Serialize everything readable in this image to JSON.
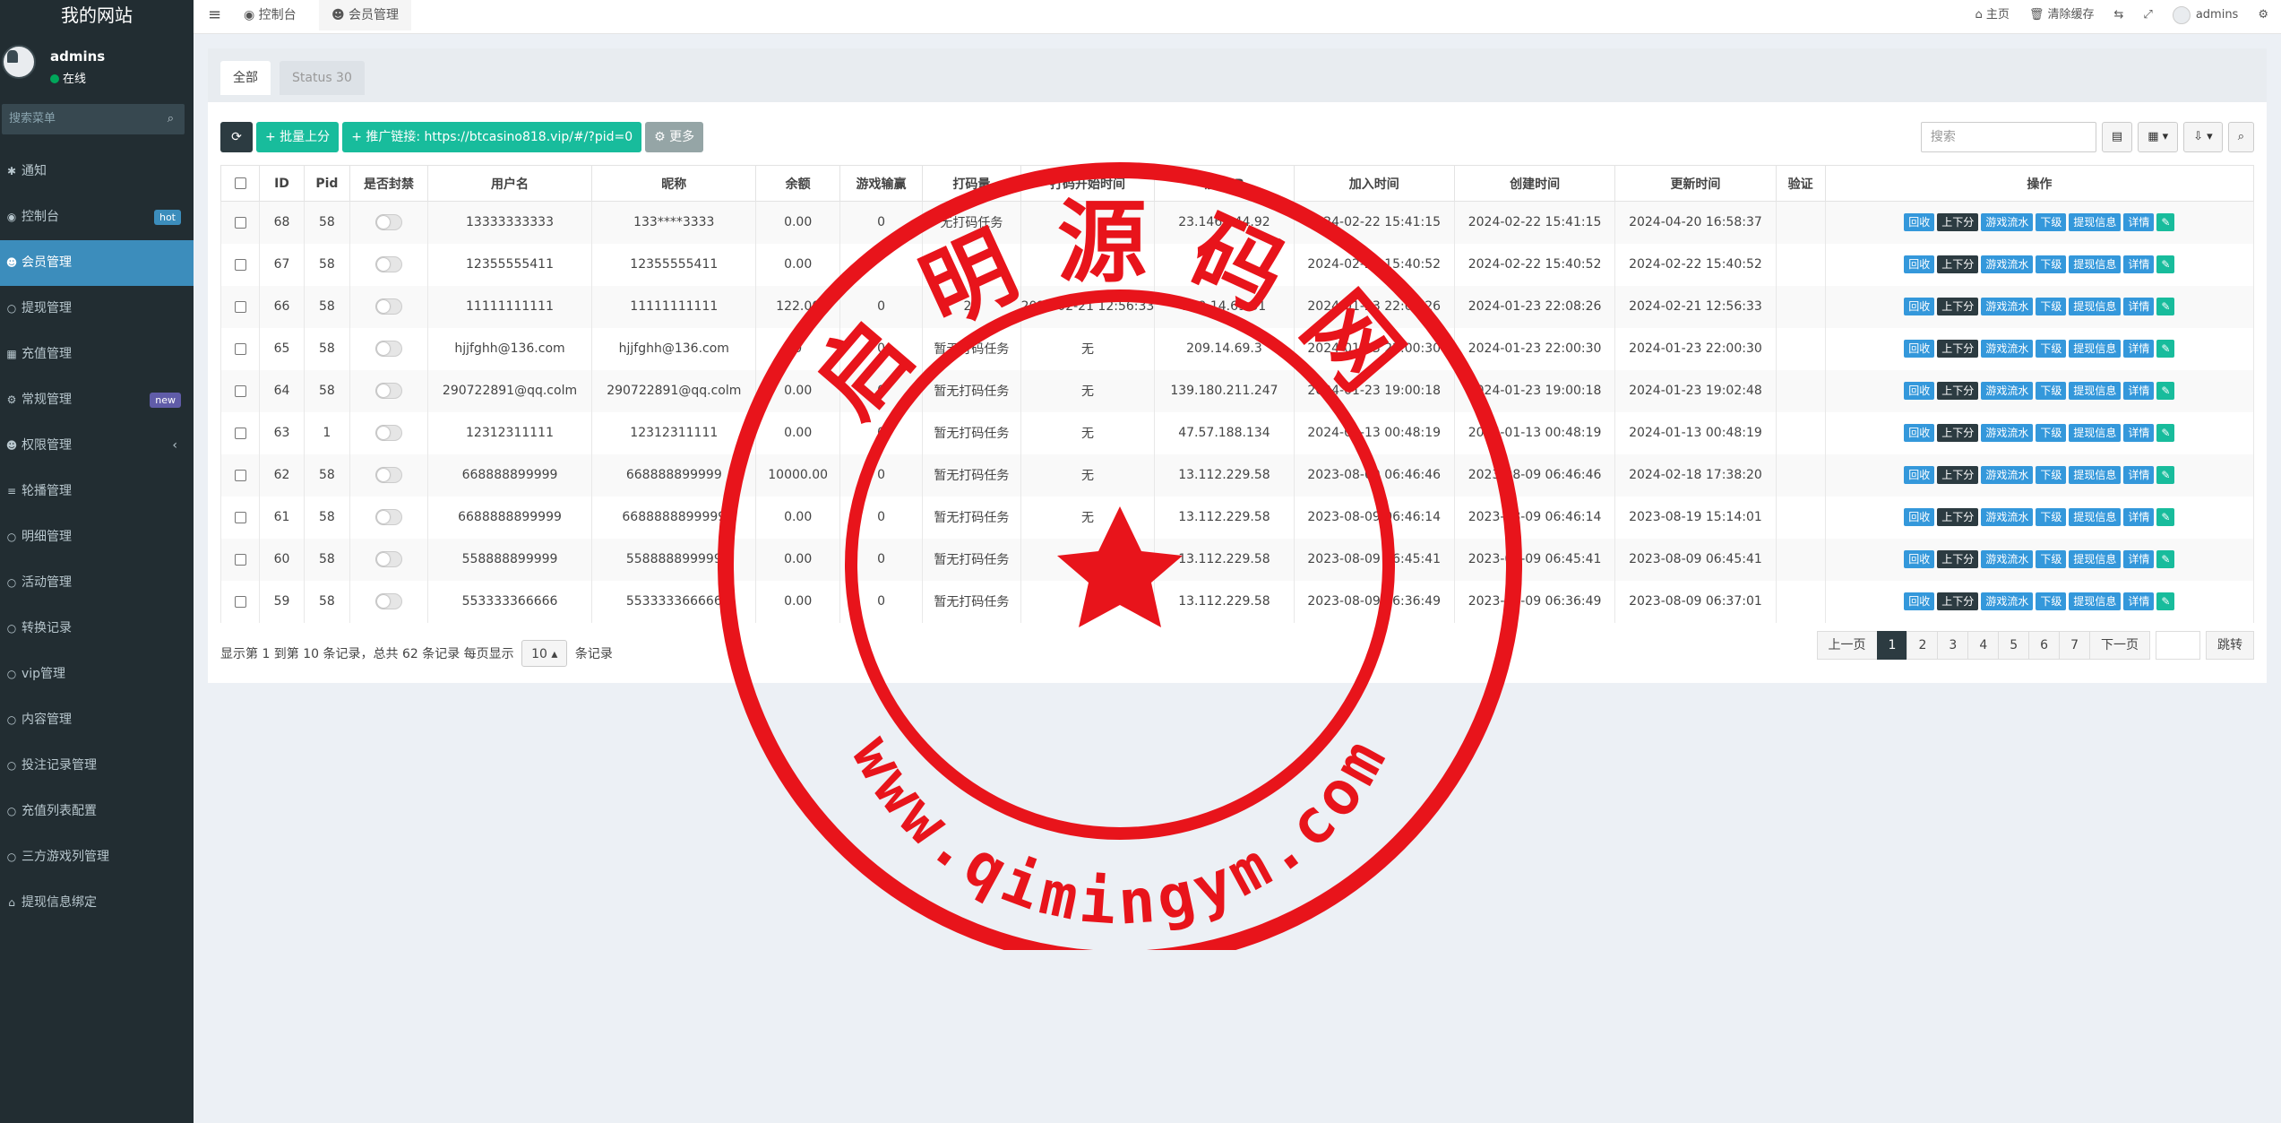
{
  "sidebar": {
    "site_title": "我的网站",
    "user": {
      "name": "admins",
      "status": "在线"
    },
    "search_placeholder": "搜索菜单",
    "items": [
      {
        "icon": "bell-icon",
        "glyph": "✱",
        "label": "通知"
      },
      {
        "icon": "dashboard-icon",
        "glyph": "◉",
        "label": "控制台",
        "badge": "hot"
      },
      {
        "icon": "users-icon",
        "glyph": "☻",
        "label": "会员管理",
        "active": true
      },
      {
        "icon": "circle-icon",
        "glyph": "○",
        "label": "提现管理"
      },
      {
        "icon": "grid-icon",
        "glyph": "▦",
        "label": "充值管理"
      },
      {
        "icon": "cogs-icon",
        "glyph": "⚙",
        "label": "常规管理",
        "badge": "new"
      },
      {
        "icon": "users-icon",
        "glyph": "☻",
        "label": "权限管理",
        "chevron": "‹"
      },
      {
        "icon": "list-icon",
        "glyph": "≡",
        "label": "轮播管理"
      },
      {
        "icon": "circle-icon",
        "glyph": "○",
        "label": "明细管理"
      },
      {
        "icon": "circle-icon",
        "glyph": "○",
        "label": "活动管理"
      },
      {
        "icon": "circle-icon",
        "glyph": "○",
        "label": "转换记录"
      },
      {
        "icon": "circle-icon",
        "glyph": "○",
        "label": "vip管理"
      },
      {
        "icon": "circle-icon",
        "glyph": "○",
        "label": "内容管理"
      },
      {
        "icon": "circle-icon",
        "glyph": "○",
        "label": "投注记录管理"
      },
      {
        "icon": "circle-icon",
        "glyph": "○",
        "label": "充值列表配置"
      },
      {
        "icon": "circle-icon",
        "glyph": "○",
        "label": "三方游戏列管理"
      },
      {
        "icon": "bank-icon",
        "glyph": "⌂",
        "label": "提现信息绑定"
      }
    ]
  },
  "topbar": {
    "tabs": [
      "控制台",
      "会员管理"
    ],
    "right": {
      "home": "主页",
      "clear_cache": "清除缓存",
      "user": "admins"
    }
  },
  "panel": {
    "tabs": [
      "全部",
      "Status 30"
    ],
    "toolbar": {
      "batch_label": "+ 批量上分",
      "promo_label": "+ 推广链接: https://btcasino818.vip/#/?pid=0",
      "more_label": "⚙ 更多"
    },
    "search_placeholder": "搜索",
    "columns": [
      "",
      "ID",
      "Pid",
      "是否封禁",
      "用户名",
      "昵称",
      "余额",
      "游戏输赢",
      "打码量",
      "打码开始时间",
      "加入IP",
      "加入时间",
      "创建时间",
      "更新时间",
      "验证",
      "操作"
    ],
    "rows": [
      {
        "id": "68",
        "pid": "58",
        "username": "13333333333",
        "nickname": "133****3333",
        "balance": "0.00",
        "winloss": "0",
        "bet": "无打码任务",
        "bet_start": "",
        "ip": "23.146.144.92",
        "join": "2024-02-22 15:41:15",
        "created": "2024-02-22 15:41:15",
        "updated": "2024-04-20 16:58:37"
      },
      {
        "id": "67",
        "pid": "58",
        "username": "12355555411",
        "nickname": "12355555411",
        "balance": "0.00",
        "winloss": "",
        "bet": "",
        "bet_start": "",
        "ip": "",
        "join": "2024-02-22 15:40:52",
        "created": "2024-02-22 15:40:52",
        "updated": "2024-02-22 15:40:52"
      },
      {
        "id": "66",
        "pid": "58",
        "username": "11111111111",
        "nickname": "11111111111",
        "balance": "122.00",
        "winloss": "0",
        "bet": "20",
        "bet_start": "2024-02-21 12:56:33",
        "ip": "209.14.69.31",
        "join": "2024-01-23 22:08:26",
        "created": "2024-01-23 22:08:26",
        "updated": "2024-02-21 12:56:33"
      },
      {
        "id": "65",
        "pid": "58",
        "username": "hjjfghh@136.com",
        "nickname": "hjjfghh@136.com",
        "balance": "0",
        "winloss": "0",
        "bet": "暂无打码任务",
        "bet_start": "无",
        "ip": "209.14.69.3",
        "join": "2024-01-23 22:00:30",
        "created": "2024-01-23 22:00:30",
        "updated": "2024-01-23 22:00:30"
      },
      {
        "id": "64",
        "pid": "58",
        "username": "290722891@qq.colm",
        "nickname": "290722891@qq.colm",
        "balance": "0.00",
        "winloss": "0",
        "bet": "暂无打码任务",
        "bet_start": "无",
        "ip": "139.180.211.247",
        "join": "2024-01-23 19:00:18",
        "created": "2024-01-23 19:00:18",
        "updated": "2024-01-23 19:02:48"
      },
      {
        "id": "63",
        "pid": "1",
        "username": "12312311111",
        "nickname": "12312311111",
        "balance": "0.00",
        "winloss": "0",
        "bet": "暂无打码任务",
        "bet_start": "无",
        "ip": "47.57.188.134",
        "join": "2024-01-13 00:48:19",
        "created": "2024-01-13 00:48:19",
        "updated": "2024-01-13 00:48:19"
      },
      {
        "id": "62",
        "pid": "58",
        "username": "668888899999",
        "nickname": "668888899999",
        "balance": "10000.00",
        "winloss": "0",
        "bet": "暂无打码任务",
        "bet_start": "无",
        "ip": "13.112.229.58",
        "join": "2023-08-09 06:46:46",
        "created": "2023-08-09 06:46:46",
        "updated": "2024-02-18 17:38:20"
      },
      {
        "id": "61",
        "pid": "58",
        "username": "6688888899999",
        "nickname": "6688888899999",
        "balance": "0.00",
        "winloss": "0",
        "bet": "暂无打码任务",
        "bet_start": "无",
        "ip": "13.112.229.58",
        "join": "2023-08-09 06:46:14",
        "created": "2023-08-09 06:46:14",
        "updated": "2023-08-19 15:14:01"
      },
      {
        "id": "60",
        "pid": "58",
        "username": "558888899999",
        "nickname": "558888899999",
        "balance": "0.00",
        "winloss": "0",
        "bet": "暂无打码任务",
        "bet_start": "",
        "ip": "13.112.229.58",
        "join": "2023-08-09 06:45:41",
        "created": "2023-08-09 06:45:41",
        "updated": "2023-08-09 06:45:41"
      },
      {
        "id": "59",
        "pid": "58",
        "username": "553333366666",
        "nickname": "553333366666",
        "balance": "0.00",
        "winloss": "0",
        "bet": "暂无打码任务",
        "bet_start": "",
        "ip": "13.112.229.58",
        "join": "2023-08-09 06:36:49",
        "created": "2023-08-09 06:36:49",
        "updated": "2023-08-09 06:37:01"
      }
    ],
    "row_actions": [
      "回收",
      "上下分",
      "游戏流水",
      "下级",
      "提现信息",
      "详情"
    ],
    "pager": {
      "info_prefix": "显示第 1 到第 10 条记录，总共 62 条记录 每页显示",
      "page_size": "10",
      "info_suffix": "条记录",
      "prev": "上一页",
      "pages": [
        "1",
        "2",
        "3",
        "4",
        "5",
        "6",
        "7"
      ],
      "next": "下一页",
      "jump": "跳转"
    }
  },
  "watermark": {
    "top_text": "启明源码网",
    "bottom_text": "www.qimingym.com",
    "color": "#e8141b"
  }
}
